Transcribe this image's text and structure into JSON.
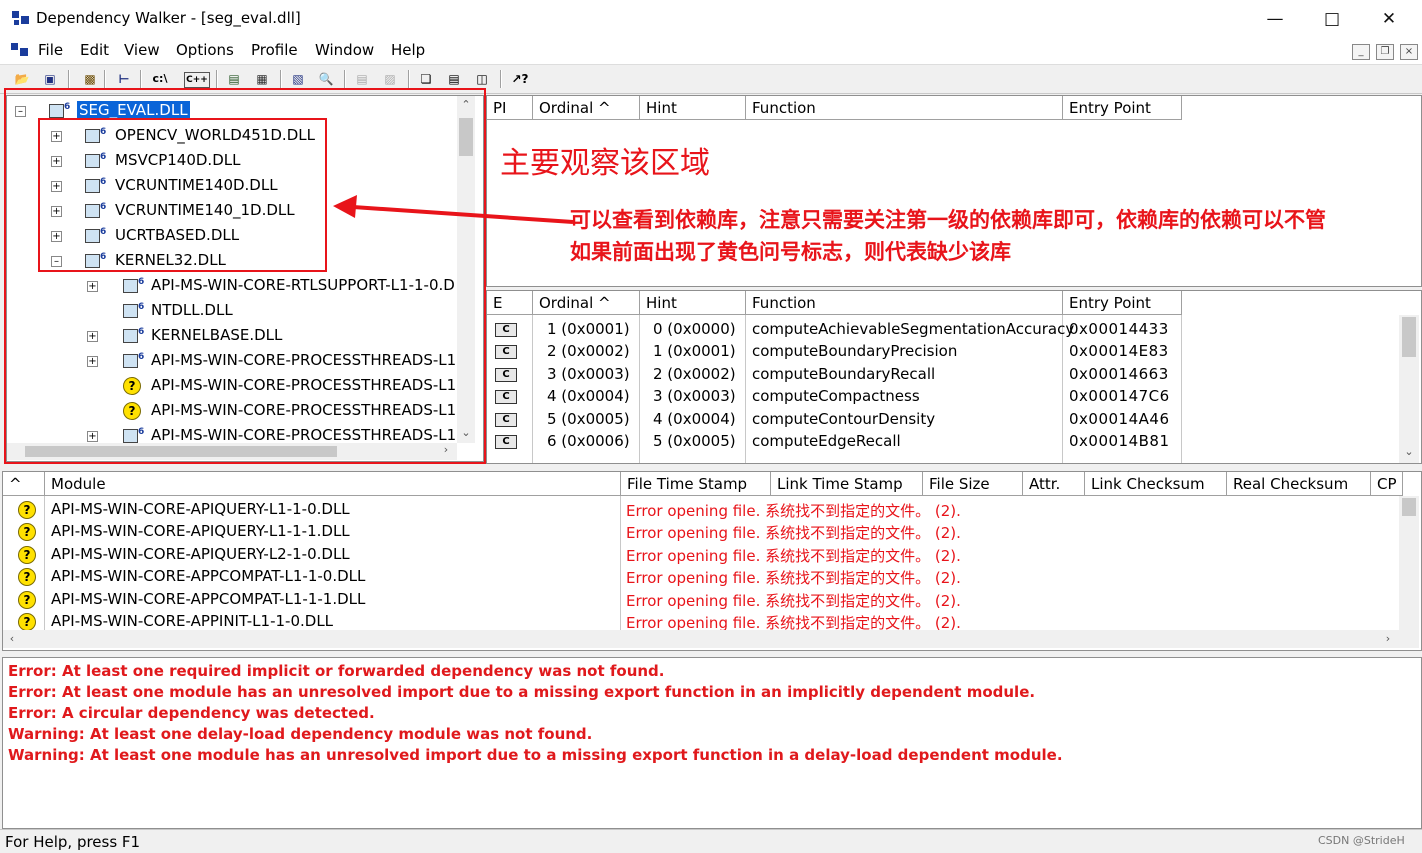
{
  "window": {
    "title": "Dependency Walker - [seg_eval.dll]"
  },
  "menu": [
    "File",
    "Edit",
    "View",
    "Options",
    "Profile",
    "Window",
    "Help"
  ],
  "toolbar_glyphs": {
    "cmd": "c:\\",
    "cpp": "C++"
  },
  "tree": {
    "root": "SEG_EVAL.DLL",
    "children": [
      {
        "label": "OPENCV_WORLD451D.DLL",
        "icon": "module-icon"
      },
      {
        "label": "MSVCP140D.DLL",
        "icon": "module-icon"
      },
      {
        "label": "VCRUNTIME140D.DLL",
        "icon": "module-icon"
      },
      {
        "label": "VCRUNTIME140_1D.DLL",
        "icon": "module-icon"
      },
      {
        "label": "UCRTBASED.DLL",
        "icon": "module-icon"
      },
      {
        "label": "KERNEL32.DLL",
        "icon": "module-icon"
      }
    ],
    "kernel32_children": [
      {
        "label": "API-MS-WIN-CORE-RTLSUPPORT-L1-1-0.D",
        "icon": "module-icon"
      },
      {
        "label": "NTDLL.DLL",
        "icon": "module-icon"
      },
      {
        "label": "KERNELBASE.DLL",
        "icon": "module-icon"
      },
      {
        "label": "API-MS-WIN-CORE-PROCESSTHREADS-L1",
        "icon": "module-icon"
      },
      {
        "label": "API-MS-WIN-CORE-PROCESSTHREADS-L1",
        "icon": "missing-question-icon"
      },
      {
        "label": "API-MS-WIN-CORE-PROCESSTHREADS-L1",
        "icon": "missing-question-icon"
      },
      {
        "label": "API-MS-WIN-CORE-PROCESSTHREADS-L1",
        "icon": "module-icon"
      }
    ]
  },
  "import_pane": {
    "headers": [
      "PI",
      "Ordinal ^",
      "Hint",
      "Function",
      "Entry Point"
    ]
  },
  "export_pane": {
    "headers": [
      "E",
      "Ordinal ^",
      "Hint",
      "Function",
      "Entry Point"
    ],
    "rows": [
      {
        "icon": "C",
        "ordinal": "1 (0x0001)",
        "hint": "0 (0x0000)",
        "function": "computeAchievableSegmentationAccuracy",
        "entry": "0x00014433"
      },
      {
        "icon": "C",
        "ordinal": "2 (0x0002)",
        "hint": "1 (0x0001)",
        "function": "computeBoundaryPrecision",
        "entry": "0x00014E83"
      },
      {
        "icon": "C",
        "ordinal": "3 (0x0003)",
        "hint": "2 (0x0002)",
        "function": "computeBoundaryRecall",
        "entry": "0x00014663"
      },
      {
        "icon": "C",
        "ordinal": "4 (0x0004)",
        "hint": "3 (0x0003)",
        "function": "computeCompactness",
        "entry": "0x000147C6"
      },
      {
        "icon": "C",
        "ordinal": "5 (0x0005)",
        "hint": "4 (0x0004)",
        "function": "computeContourDensity",
        "entry": "0x00014A46"
      },
      {
        "icon": "C",
        "ordinal": "6 (0x0006)",
        "hint": "5 (0x0005)",
        "function": "computeEdgeRecall",
        "entry": "0x00014B81"
      }
    ]
  },
  "module_list": {
    "headers": [
      "^",
      "Module",
      "File Time Stamp",
      "Link Time Stamp",
      "File Size",
      "Attr.",
      "Link Checksum",
      "Real Checksum",
      "CP"
    ],
    "rows": [
      {
        "module": "API-MS-WIN-CORE-APIQUERY-L1-1-0.DLL",
        "status": "Error opening file. 系统找不到指定的文件。 (2)."
      },
      {
        "module": "API-MS-WIN-CORE-APIQUERY-L1-1-1.DLL",
        "status": "Error opening file. 系统找不到指定的文件。 (2)."
      },
      {
        "module": "API-MS-WIN-CORE-APIQUERY-L2-1-0.DLL",
        "status": "Error opening file. 系统找不到指定的文件。 (2)."
      },
      {
        "module": "API-MS-WIN-CORE-APPCOMPAT-L1-1-0.DLL",
        "status": "Error opening file. 系统找不到指定的文件。 (2)."
      },
      {
        "module": "API-MS-WIN-CORE-APPCOMPAT-L1-1-1.DLL",
        "status": "Error opening file. 系统找不到指定的文件。 (2)."
      },
      {
        "module": "API-MS-WIN-CORE-APPINIT-L1-1-0.DLL",
        "status": "Error opening file. 系统找不到指定的文件。 (2)."
      }
    ]
  },
  "log": [
    "Error: At least one required implicit or forwarded dependency was not found.",
    "Error: At least one module has an unresolved import due to a missing export function in an implicitly dependent module.",
    "Error: A circular dependency was detected.",
    "Warning: At least one delay-load dependency module was not found.",
    "Warning: At least one module has an unresolved import due to a missing export function in a delay-load dependent module."
  ],
  "status_bar": {
    "text": "For Help, press F1"
  },
  "annotations": {
    "heading": "主要观察该区域",
    "note_line1": "可以查看到依赖库，注意只需要关注第一级的依赖库即可，依赖库的依赖可以不管",
    "note_line2": "如果前面出现了黄色问号标志，则代表缺少该库",
    "color": "#e8141a"
  },
  "watermark": "CSDN @StrideH"
}
